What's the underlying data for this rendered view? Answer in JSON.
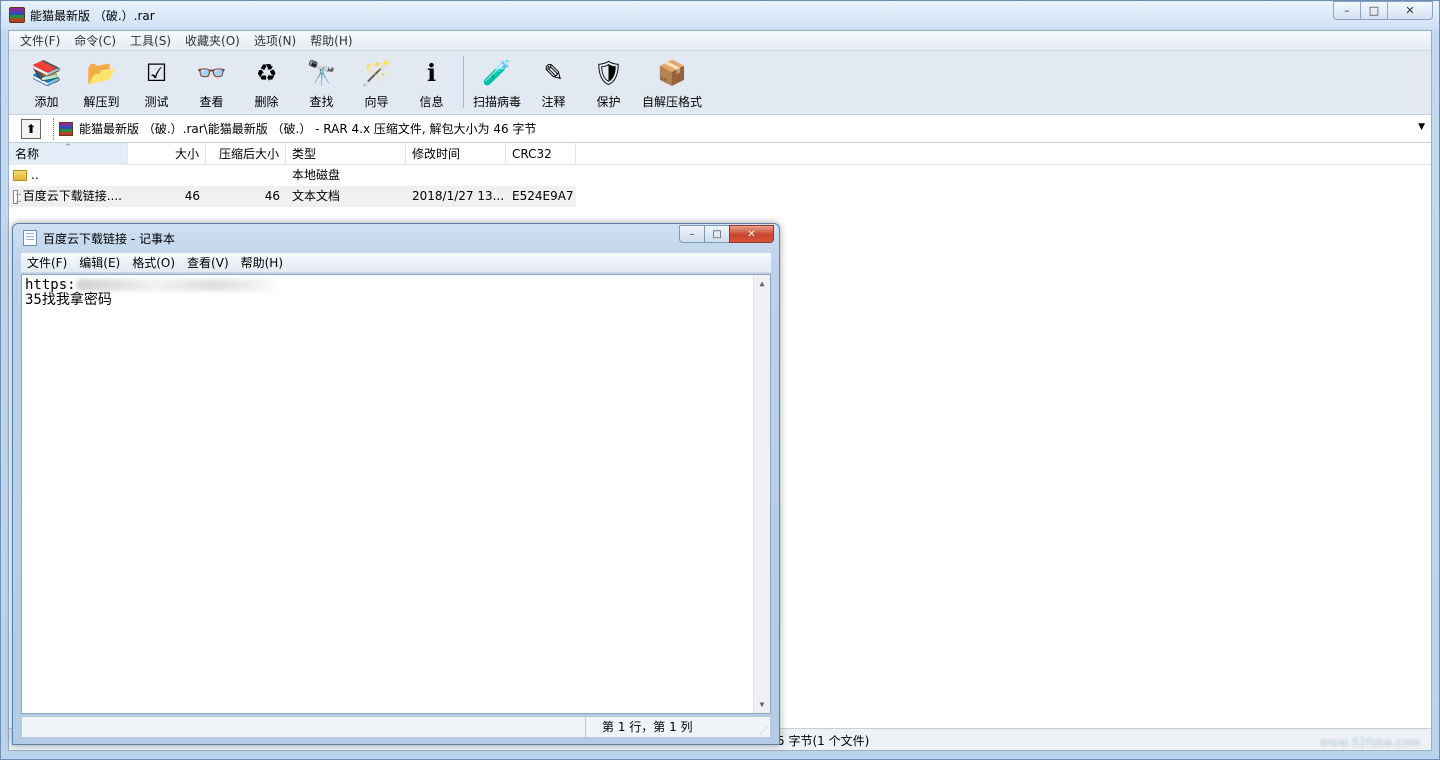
{
  "winrar": {
    "title": "能猫最新版 （破.）.rar",
    "menu": [
      "文件(F)",
      "命令(C)",
      "工具(S)",
      "收藏夹(O)",
      "选项(N)",
      "帮助(H)"
    ],
    "toolbar": [
      {
        "label": "添加",
        "icon": "add-archive-icon"
      },
      {
        "label": "解压到",
        "icon": "extract-to-icon"
      },
      {
        "label": "测试",
        "icon": "test-icon"
      },
      {
        "label": "查看",
        "icon": "view-icon"
      },
      {
        "label": "删除",
        "icon": "delete-icon"
      },
      {
        "label": "查找",
        "icon": "find-icon"
      },
      {
        "label": "向导",
        "icon": "wizard-icon"
      },
      {
        "label": "信息",
        "icon": "info-icon"
      },
      {
        "label": "扫描病毒",
        "icon": "virus-scan-icon"
      },
      {
        "label": "注释",
        "icon": "comment-icon"
      },
      {
        "label": "保护",
        "icon": "protect-icon"
      },
      {
        "label": "自解压格式",
        "icon": "sfx-icon"
      }
    ],
    "address": "能猫最新版 （破.）.rar\\能猫最新版 （破.） - RAR 4.x 压缩文件, 解包大小为 46 字节",
    "columns": {
      "name": "名称",
      "size": "大小",
      "packed": "压缩后大小",
      "type": "类型",
      "modified": "修改时间",
      "crc": "CRC32"
    },
    "rows": [
      {
        "name": "..",
        "size": "",
        "packed": "",
        "type": "本地磁盘",
        "modified": "",
        "crc": ""
      },
      {
        "name": "百度云下载链接....",
        "size": "46",
        "packed": "46",
        "type": "文本文档",
        "modified": "2018/1/27 13...",
        "crc": "E524E9A7"
      }
    ],
    "status": "5 字节(1 个文件)",
    "watermark": "www.52fzba.com"
  },
  "notepad": {
    "title": "百度云下载链接 - 记事本",
    "menu": [
      "文件(F)",
      "编辑(E)",
      "格式(O)",
      "查看(V)",
      "帮助(H)"
    ],
    "lines": [
      "https:",
      "35找我拿密码"
    ],
    "status": "第 1 行，第 1 列"
  },
  "colors": {
    "accent": "#3f6fa6",
    "selection": "#e3edf8",
    "close_button": "#c9452c"
  }
}
